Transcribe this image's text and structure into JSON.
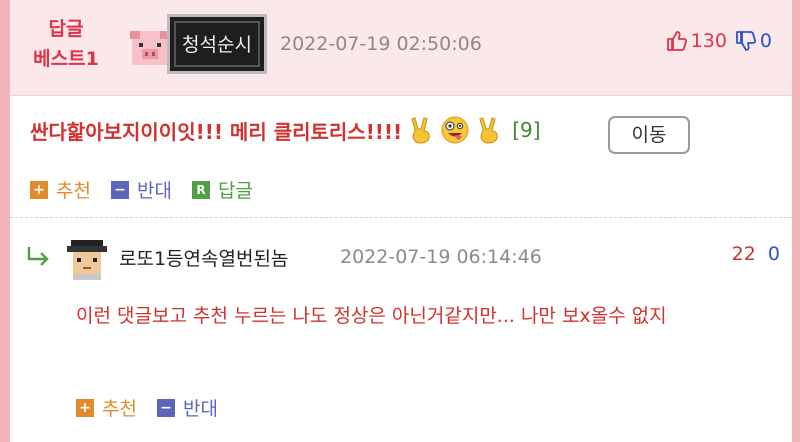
{
  "best_comment": {
    "badge_line1": "답글",
    "badge_line2": "베스트1",
    "avatar_icon": "pig-face-icon",
    "nickname": "청석순시",
    "date": "2022-07-19 02:50:06",
    "upvotes": "130",
    "downvotes": "0",
    "text": "싼다핥아보지이이잇!!! 메리 클리토리스!!!!",
    "emojis": [
      "victory-hand-icon",
      "zany-face-icon",
      "victory-hand-icon"
    ],
    "reply_count": "[9]",
    "move_button": "이동",
    "actions": {
      "recommend": "추천",
      "oppose": "반대",
      "reply": "답글",
      "reply_badge": "R"
    }
  },
  "reply": {
    "avatar_icon": "pixel-avatar-icon",
    "nickname": "로또1등연속열번된놈",
    "date": "2022-07-19 06:14:46",
    "upvotes": "22",
    "downvotes": "0",
    "text": "이런 댓글보고 추천 누르는 나도 정상은 아닌거같지만... 나만 보x올수 없지",
    "actions": {
      "recommend": "추천",
      "oppose": "반대"
    }
  },
  "colors": {
    "background": "#f3b4ba",
    "header": "#fbe8ea",
    "red": "#d0322f",
    "blue": "#2a55c8",
    "orange": "#e38b2c",
    "purple": "#5b66b8",
    "green": "#4ea043"
  }
}
